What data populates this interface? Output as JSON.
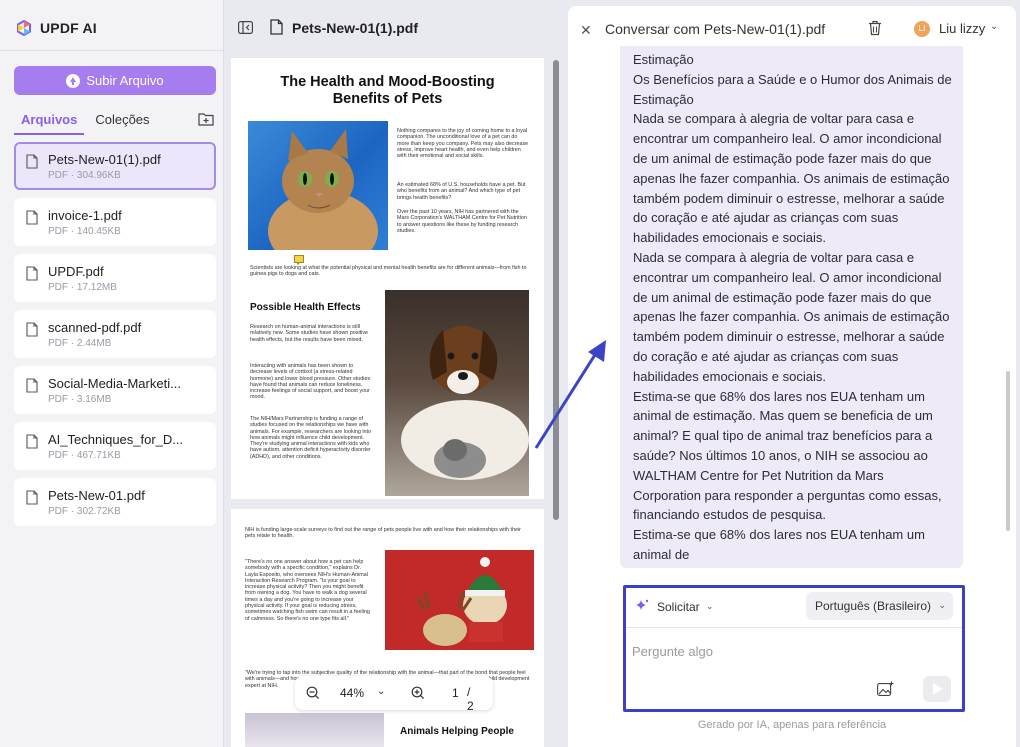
{
  "app": {
    "name": "UPDF AI"
  },
  "sidebar": {
    "upload_label": "Subir Arquivo",
    "tabs": [
      {
        "label": "Arquivos"
      },
      {
        "label": "Coleções"
      }
    ],
    "files": [
      {
        "name": "Pets-New-01(1).pdf",
        "meta": "PDF · 304.96KB"
      },
      {
        "name": "invoice-1.pdf",
        "meta": "PDF · 140.45KB"
      },
      {
        "name": "UPDF.pdf",
        "meta": "PDF · 17.12MB"
      },
      {
        "name": "scanned-pdf.pdf",
        "meta": "PDF · 2.44MB"
      },
      {
        "name": "Social-Media-Marketi...",
        "meta": "PDF · 3.16MB"
      },
      {
        "name": "AI_Techniques_for_D...",
        "meta": "PDF · 467.71KB"
      },
      {
        "name": "Pets-New-01.pdf",
        "meta": "PDF · 302.72KB"
      }
    ]
  },
  "document": {
    "title": "Pets-New-01(1).pdf",
    "page1": {
      "title": "The Health and Mood-Boosting Benefits of Pets",
      "intro": "Nothing compares to the joy of coming home to a loyal companion. The unconditional love of a pet can do more than keep you company. Pets may also decrease stress, improve heart health, and even help children with their emotional and social skills.",
      "stat": "An estimated 68% of U.S. households have a pet. But who benefits from an animal? And which type of pet brings health benefits?",
      "nih": "Over the past 10 years, NIH has partnered with the Mars Corporation's WALTHAM Centre for Pet Nutrition to answer questions like these by funding research studies.",
      "caption": "Scientists are looking at what the potential physical and mental health benefits are for different animals—from fish to guinea pigs to dogs and cats.",
      "section_title": "Possible Health Effects",
      "section_p1": "Research on human-animal interactions is still relatively new. Some studies have shown positive health effects, but the results have been mixed.",
      "section_p2": "Interacting with animals has been shown to decrease levels of cortisol (a stress-related hormone) and lower blood pressure. Other studies have found that animals can reduce loneliness, increase feelings of social support, and boost your mood.",
      "section_p3": "The NIH/Mars Partnership is funding a range of studies focused on the relationships we have with animals. For example, researchers are looking into how animals might influence child development. They're studying animal interactions with kids who have autism, attention deficit hyperactivity disorder (ADHD), and other conditions."
    },
    "page2": {
      "intro": "NIH is funding large-scale surveys to find out the range of pets people live with and how their relationships with their pets relate to health.",
      "quote1": "\"There's no one answer about how a pet can help somebody with a specific condition,\" explains Dr. Layla Esposito, who oversees NIH's Human-Animal Interaction Research Program. \"Is your goal to increase physical activity? Then you might benefit from owning a dog. You have to walk a dog several times a day and you're going to increase your physical activity. If your goal is reducing stress, sometimes watching fish swim can result in a feeling of calmness. So there's no one type fits all.\"",
      "quote2": "\"We're trying to tap into the subjective quality of the relationship with the animal—that part of the bond that people feel with animals—and how that translates into some of the health benefits,\" explains Dr. James Griffin, a child development expert at NIH.",
      "section_title": "Animals Helping People"
    },
    "zoom": "44%",
    "page_current": "1",
    "page_total": "2"
  },
  "chat": {
    "title": "Conversar com Pets-New-01(1).pdf",
    "user_initials": "LI",
    "user_name": "Liu lizzy",
    "message_lines": [
      "Estimação",
      "Os Benefícios para a Saúde e o Humor dos Animais de",
      "Estimação",
      "Nada se compara à alegria de voltar para casa e",
      "encontrar um companheiro leal. O amor incondicional",
      "de um animal de estimação pode fazer mais do que",
      "apenas lhe fazer companhia. Os animais de estimação",
      "também podem diminuir o estresse, melhorar a saúde",
      "do coração e até ajudar as crianças com suas",
      "habilidades emocionais e sociais.",
      "Nada se compara à alegria de voltar para casa e",
      "encontrar um companheiro leal. O amor incondicional",
      "de um animal de estimação pode fazer mais do que",
      "apenas lhe fazer companhia. Os animais de estimação",
      "também podem diminuir o estresse, melhorar a saúde",
      "do coração e até ajudar as crianças com suas",
      "habilidades emocionais e sociais.",
      "Estima-se que 68% dos lares nos EUA tenham um",
      "animal de estimação. Mas quem se beneficia de um",
      "animal? E qual tipo de animal traz benefícios para a",
      "saúde? Nos últimos 10 anos, o NIH se associou ao",
      "WALTHAM Centre for Pet Nutrition da Mars",
      "Corporation para responder a perguntas como essas,",
      "financiando estudos de pesquisa.",
      "Estima-se que 68% dos lares nos EUA tenham um",
      "animal de"
    ],
    "mode_label": "Solicitar",
    "language": "Português (Brasileiro)",
    "input_placeholder": "Pergunte algo",
    "footer_note": "Gerado por IA, apenas para referência"
  },
  "colors": {
    "accent": "#a67dee",
    "highlight_border": "#3e3ec6",
    "annotation_arrow": "#3b45c4"
  }
}
